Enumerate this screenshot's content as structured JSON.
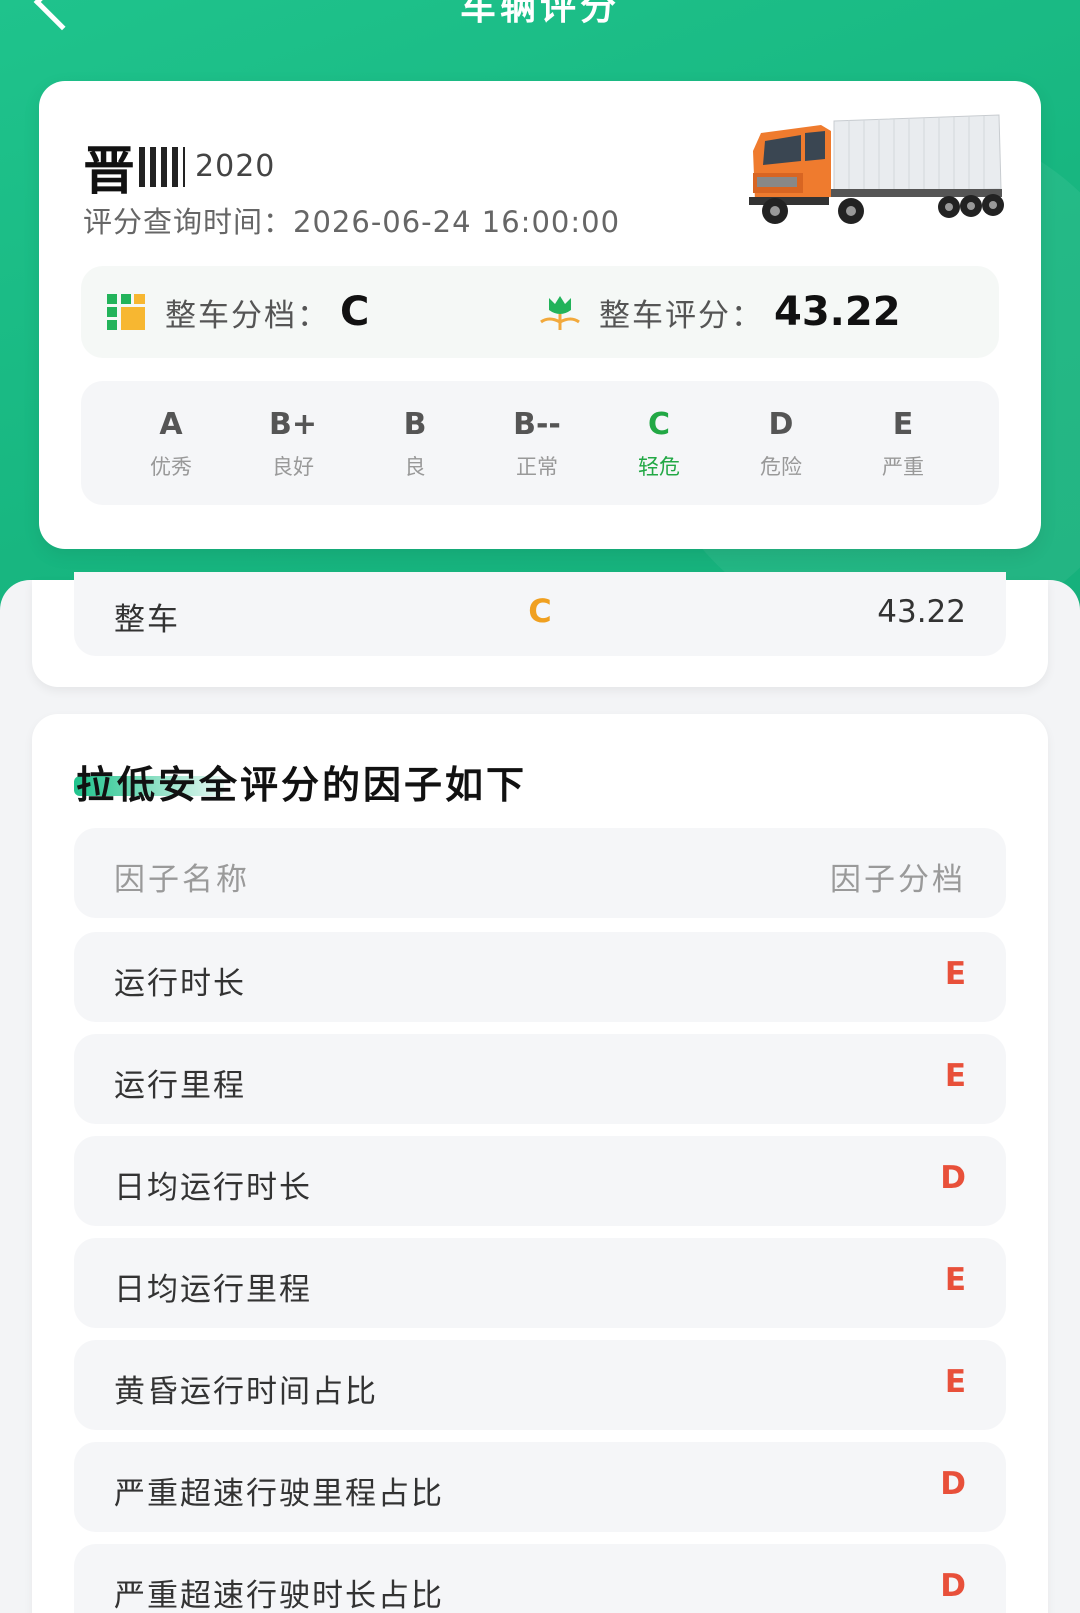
{
  "header": {
    "title": "车辆评分"
  },
  "vehicle": {
    "plate_prefix": "晋",
    "plate_rest": "2020",
    "query_time_label": "评分查询时间：",
    "query_time_value": "2026-06-24 16:00:00"
  },
  "summary": {
    "level_label": "整车分档：",
    "level_value": "C",
    "score_label": "整车评分：",
    "score_value": "43.22"
  },
  "grades": [
    {
      "letter": "A",
      "desc": "优秀",
      "active": false
    },
    {
      "letter": "B+",
      "desc": "良好",
      "active": false
    },
    {
      "letter": "B",
      "desc": "良",
      "active": false
    },
    {
      "letter": "B--",
      "desc": "正常",
      "active": false
    },
    {
      "letter": "C",
      "desc": "轻危",
      "active": true
    },
    {
      "letter": "D",
      "desc": "危险",
      "active": false
    },
    {
      "letter": "E",
      "desc": "严重",
      "active": false
    }
  ],
  "overall": {
    "name": "整车",
    "grade": "C",
    "score": "43.22"
  },
  "factors": {
    "title": "拉低安全评分的因子如下",
    "col_name": "因子名称",
    "col_grade": "因子分档",
    "rows": [
      {
        "name": "运行时长",
        "grade": "E"
      },
      {
        "name": "运行里程",
        "grade": "E"
      },
      {
        "name": "日均运行时长",
        "grade": "D"
      },
      {
        "name": "日均运行里程",
        "grade": "E"
      },
      {
        "name": "黄昏运行时间占比",
        "grade": "E"
      },
      {
        "name": "严重超速行驶里程占比",
        "grade": "D"
      },
      {
        "name": "严重超速行驶时长占比",
        "grade": "D"
      }
    ]
  },
  "colors": {
    "brand_green": "#1fc38c",
    "active_grade": "#22a845",
    "warn_orange": "#f0a020",
    "danger_red": "#e8503a"
  }
}
